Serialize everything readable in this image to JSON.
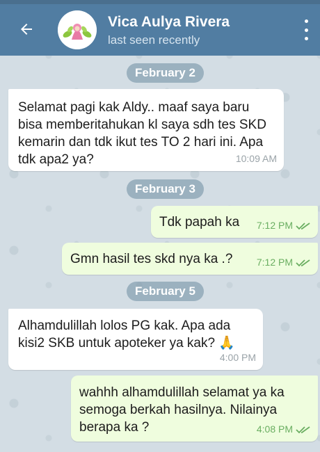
{
  "header": {
    "title": "Vica Aulya Rivera",
    "status": "last seen recently"
  },
  "dates": [
    "February 2",
    "February 3",
    "February 5"
  ],
  "messages": [
    {
      "dir": "in",
      "text": "Selamat pagi kak Aldy.. maaf saya baru bisa memberitahukan kl saya sdh tes SKD kemarin dan tdk ikut tes TO 2 hari ini. Apa tdk apa2 ya?",
      "time": "10:09 AM"
    },
    {
      "dir": "out",
      "text": "Tdk papah ka",
      "time": "7:12 PM"
    },
    {
      "dir": "out",
      "text": "Gmn hasil tes skd nya ka .?",
      "time": "7:12 PM"
    },
    {
      "dir": "in",
      "text": "Alhamdulillah lolos PG kak. Apa ada kisi2 SKB untuk apoteker ya kak? 🙏",
      "time": "4:00 PM"
    },
    {
      "dir": "out",
      "text": "wahhh alhamdulillah selamat ya ka semoga berkah hasilnya. Nilainya berapa ka ?",
      "time": "4:08 PM"
    }
  ],
  "icons": {
    "back": "arrow-left-icon",
    "menu": "more-vertical-icon",
    "read": "double-check-icon"
  },
  "colors": {
    "header": "#517da2",
    "incoming_bubble": "#ffffff",
    "outgoing_bubble": "#effdde",
    "read_check": "#6aae61"
  }
}
